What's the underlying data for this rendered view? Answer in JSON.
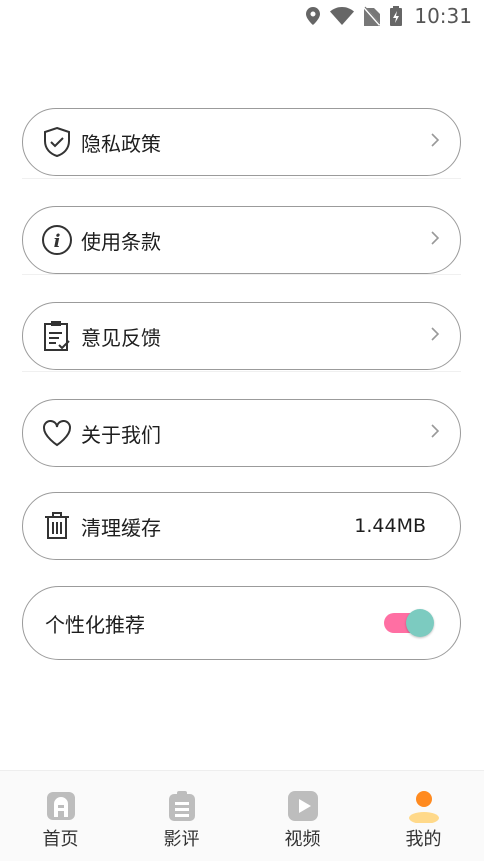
{
  "status_bar": {
    "time": "10:31"
  },
  "menu": {
    "privacy": {
      "label": "隐私政策",
      "icon": "shield-check-icon"
    },
    "terms": {
      "label": "使用条款",
      "icon": "info-icon"
    },
    "feedback": {
      "label": "意见反馈",
      "icon": "clipboard-icon"
    },
    "about": {
      "label": "关于我们",
      "icon": "heart-icon"
    },
    "cache": {
      "label": "清理缓存",
      "value": "1.44MB",
      "icon": "trash-icon"
    },
    "recommend": {
      "label": "个性化推荐",
      "enabled": true
    }
  },
  "colors": {
    "toggle_track": "#ff6fa3",
    "toggle_thumb": "#7ccbc0",
    "active_tab": "#ff8a1f"
  },
  "tabbar": {
    "tabs": [
      {
        "label": "首页",
        "icon": "home-icon"
      },
      {
        "label": "影评",
        "icon": "review-icon"
      },
      {
        "label": "视频",
        "icon": "play-icon"
      },
      {
        "label": "我的",
        "icon": "user-icon",
        "active": true
      }
    ]
  }
}
